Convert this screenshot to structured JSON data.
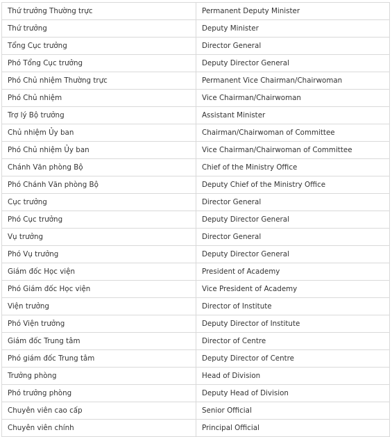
{
  "rows": [
    [
      "Thứ trưởng Thường trực",
      "Permanent Deputy Minister"
    ],
    [
      "Thứ trưởng",
      "Deputy Minister"
    ],
    [
      "Tổng Cục trưởng",
      "Director General"
    ],
    [
      "Phó Tổng Cục trưởng",
      "Deputy Director General"
    ],
    [
      "Phó Chủ nhiệm Thường trực",
      "Permanent Vice Chairman/Chairwoman"
    ],
    [
      "Phó Chủ nhiệm",
      "Vice Chairman/Chairwoman"
    ],
    [
      "Trợ lý Bộ trưởng",
      "Assistant Minister"
    ],
    [
      "Chủ nhiệm Ủy ban",
      "Chairman/Chairwoman of Committee"
    ],
    [
      "Phó Chủ nhiệm Ủy ban",
      "Vice Chairman/Chairwoman of Committee"
    ],
    [
      "Chánh Văn phòng Bộ",
      "Chief of the Ministry Office"
    ],
    [
      "Phó Chánh Văn phòng Bộ",
      "Deputy Chief of the Ministry Office"
    ],
    [
      "Cục trưởng",
      "Director General"
    ],
    [
      "Phó Cục trưởng",
      "Deputy Director General"
    ],
    [
      "Vụ trưởng",
      "Director General"
    ],
    [
      "Phó Vụ trưởng",
      "Deputy Director General"
    ],
    [
      "Giám đốc Học viện",
      "President of Academy"
    ],
    [
      "Phó Giám đốc Học viện",
      "Vice President of Academy"
    ],
    [
      "Viện trưởng",
      "Director of Institute"
    ],
    [
      "Phó Viện trưởng",
      "Deputy Director of Institute"
    ],
    [
      "Giám đốc Trung tâm",
      "Director of Centre"
    ],
    [
      "Phó giám đốc Trung tâm",
      "Deputy Director of Centre"
    ],
    [
      "Trưởng phòng",
      "Head of Division"
    ],
    [
      "Phó trưởng phòng",
      "Deputy Head of Division"
    ],
    [
      "Chuyên viên cao cấp",
      "Senior Official"
    ],
    [
      "Chuyên viên chính",
      "Principal Official"
    ]
  ]
}
